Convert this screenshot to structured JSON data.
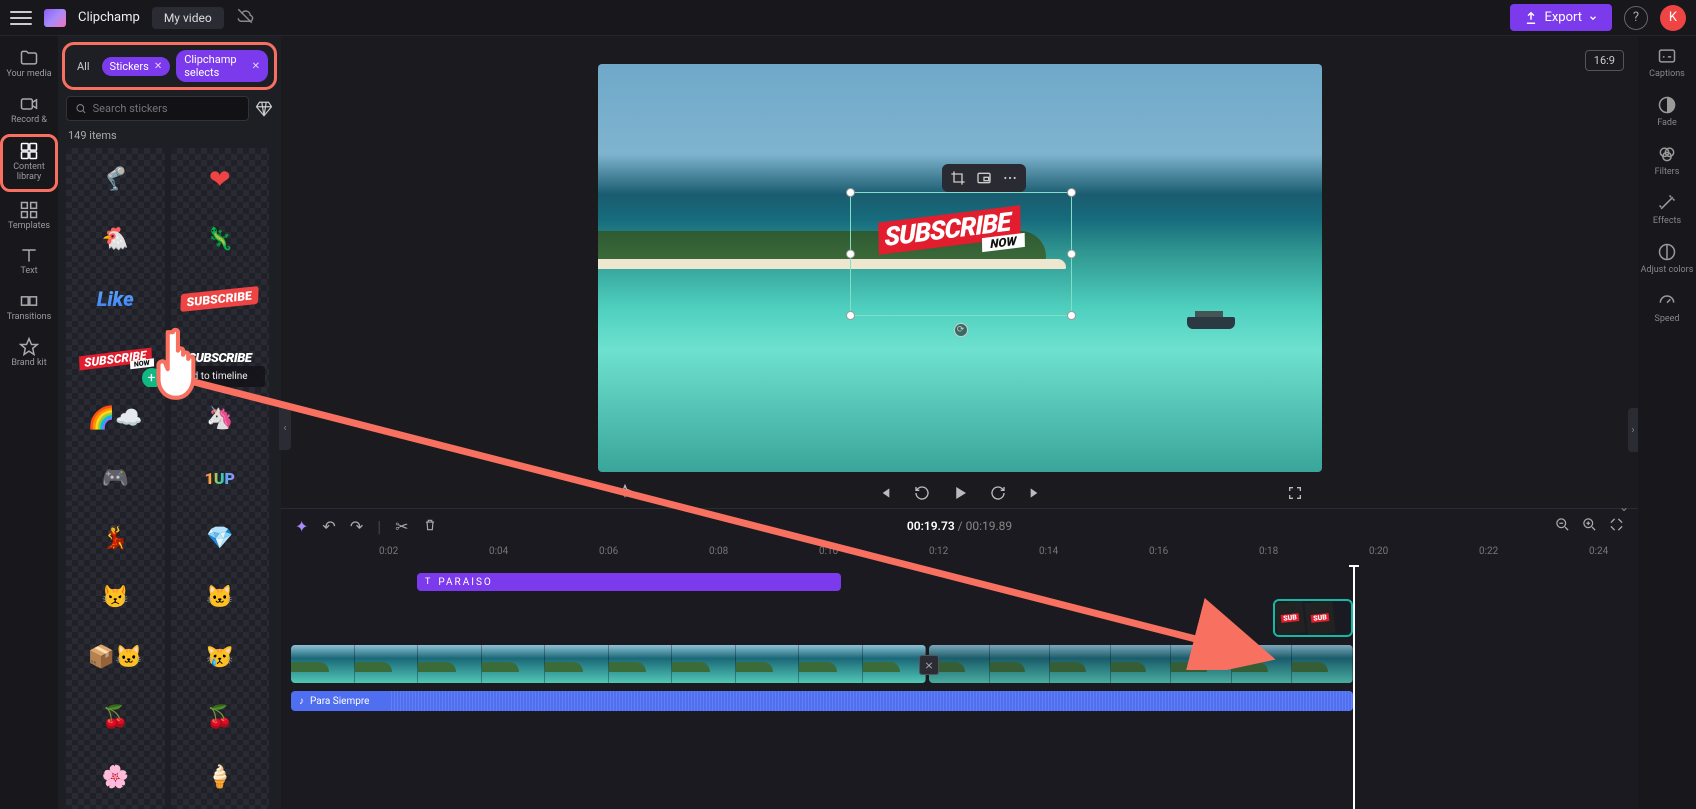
{
  "topbar": {
    "brand": "Clipchamp",
    "project": "My video",
    "export": "Export",
    "avatar_initial": "K"
  },
  "left_rail": [
    {
      "id": "your-media",
      "label": "Your media"
    },
    {
      "id": "record",
      "label": "Record &"
    },
    {
      "id": "content-library",
      "label": "Content library",
      "active": true
    },
    {
      "id": "templates",
      "label": "Templates"
    },
    {
      "id": "text",
      "label": "Text"
    },
    {
      "id": "transitions",
      "label": "Transitions"
    },
    {
      "id": "brand-kit",
      "label": "Brand kit"
    }
  ],
  "panel": {
    "filter_all": "All",
    "filters": [
      {
        "label": "Stickers"
      },
      {
        "label": "Clipchamp selects"
      }
    ],
    "search_placeholder": "Search stickers",
    "count": "149 items",
    "add_tooltip": "Add to timeline"
  },
  "stickerSubscribeShort": "SUB",
  "preview": {
    "aspect": "16:9",
    "sticker_main": "SUBSCRIBE",
    "sticker_sub": "NOW"
  },
  "player": {
    "time_current": "00:19.73",
    "time_total": "00:19.89"
  },
  "timeline": {
    "ticks": [
      "0:02",
      "0:04",
      "0:06",
      "0:08",
      "0:10",
      "0:12",
      "0:14",
      "0:16",
      "0:18",
      "0:20",
      "0:22",
      "0:24"
    ],
    "text_clip": "PARAISO",
    "audio_clip": "Para Siempre"
  },
  "right_rail": [
    {
      "id": "captions",
      "label": "Captions"
    },
    {
      "id": "fade",
      "label": "Fade"
    },
    {
      "id": "filters",
      "label": "Filters"
    },
    {
      "id": "effects",
      "label": "Effects"
    },
    {
      "id": "adjust",
      "label": "Adjust colors"
    },
    {
      "id": "speed",
      "label": "Speed"
    }
  ]
}
